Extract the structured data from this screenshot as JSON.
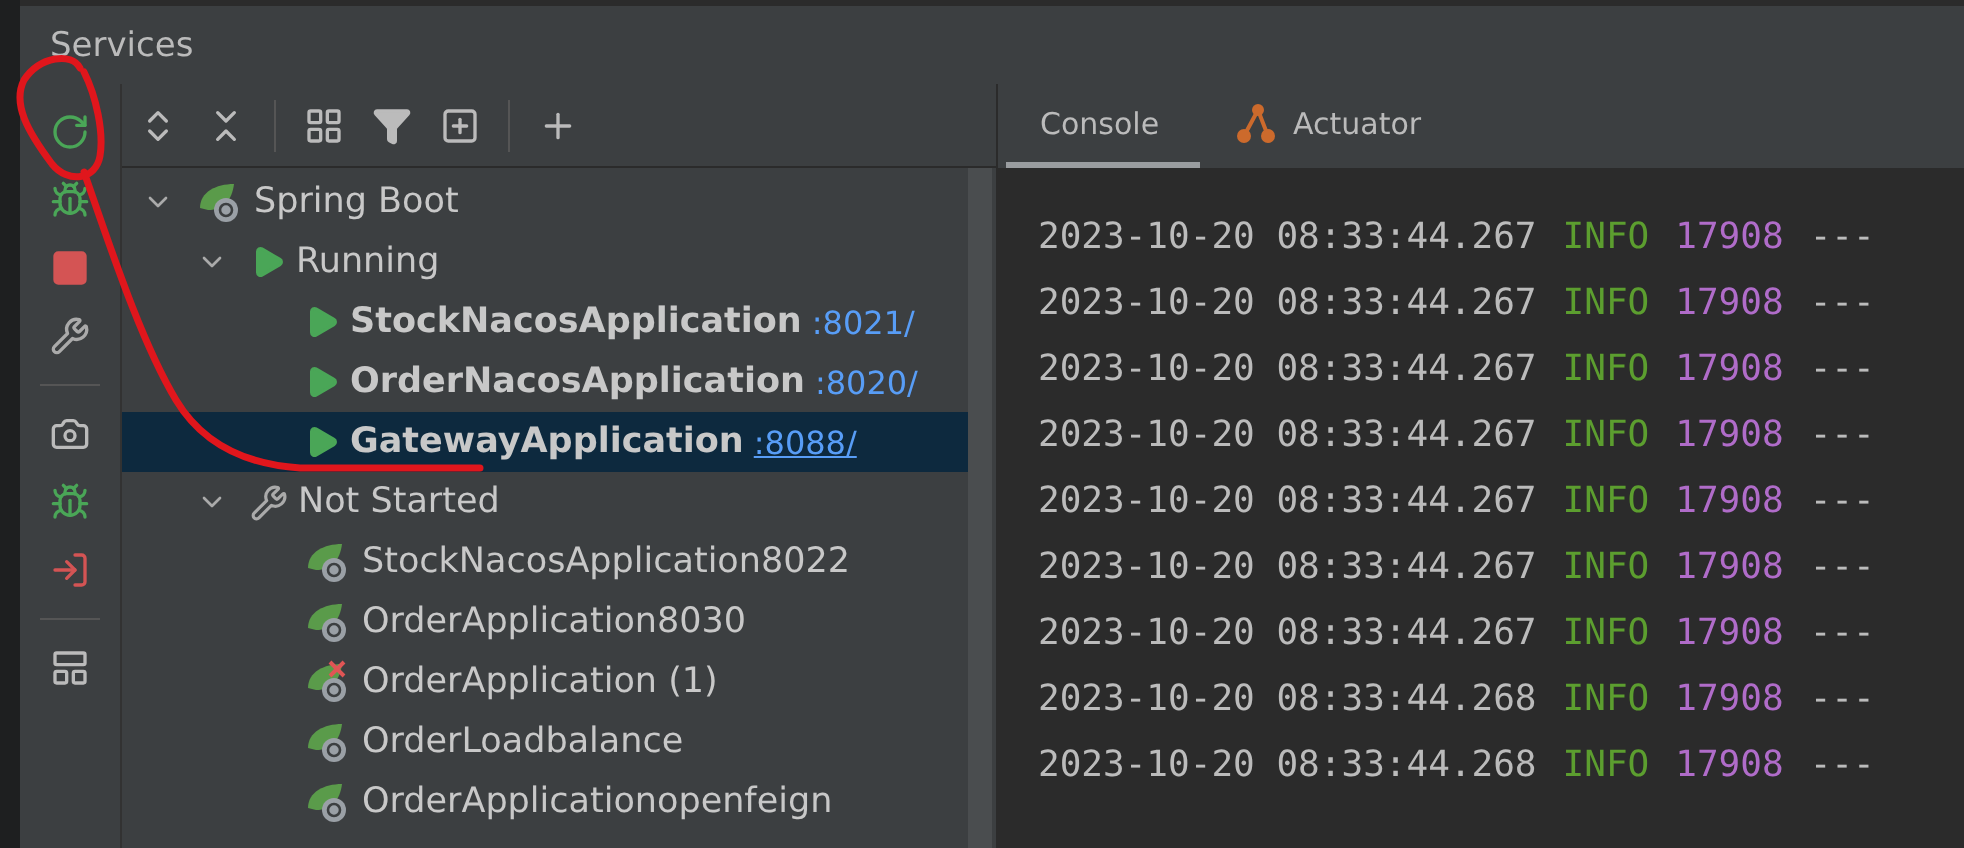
{
  "window": {
    "title": "Services"
  },
  "tabs": [
    {
      "label": "Console",
      "selected": true,
      "kind": "console"
    },
    {
      "label": "Actuator",
      "selected": false,
      "kind": "actuator"
    }
  ],
  "tree": [
    {
      "label": "Spring Boot",
      "kind": "springboot",
      "expanded": true,
      "children": [
        {
          "label": "Running",
          "kind": "running",
          "expanded": true,
          "children": [
            {
              "label": "StockNacosApplication",
              "port": ":8021/",
              "kind": "app-running",
              "selected": false
            },
            {
              "label": "OrderNacosApplication",
              "port": ":8020/",
              "kind": "app-running",
              "selected": false
            },
            {
              "label": "GatewayApplication",
              "port": ":8088/",
              "kind": "app-running",
              "selected": true
            }
          ]
        },
        {
          "label": "Not Started",
          "kind": "notstarted",
          "expanded": true,
          "children": [
            {
              "label": "StockNacosApplication8022",
              "kind": "app",
              "error": false,
              "selected": false
            },
            {
              "label": "OrderApplication8030",
              "kind": "app",
              "error": false,
              "selected": false
            },
            {
              "label": "OrderApplication (1)",
              "kind": "app",
              "error": true,
              "selected": false
            },
            {
              "label": "OrderLoadbalance",
              "kind": "app",
              "error": false,
              "selected": false
            },
            {
              "label": "OrderApplicationopenfeign",
              "kind": "app",
              "error": false,
              "selected": false
            }
          ]
        }
      ]
    }
  ],
  "log": [
    {
      "date": "2023-10-20",
      "time": "08:33:44.267",
      "level": "INFO",
      "pid": "17908",
      "sep": "---"
    },
    {
      "date": "2023-10-20",
      "time": "08:33:44.267",
      "level": "INFO",
      "pid": "17908",
      "sep": "---"
    },
    {
      "date": "2023-10-20",
      "time": "08:33:44.267",
      "level": "INFO",
      "pid": "17908",
      "sep": "---"
    },
    {
      "date": "2023-10-20",
      "time": "08:33:44.267",
      "level": "INFO",
      "pid": "17908",
      "sep": "---"
    },
    {
      "date": "2023-10-20",
      "time": "08:33:44.267",
      "level": "INFO",
      "pid": "17908",
      "sep": "---"
    },
    {
      "date": "2023-10-20",
      "time": "08:33:44.267",
      "level": "INFO",
      "pid": "17908",
      "sep": "---"
    },
    {
      "date": "2023-10-20",
      "time": "08:33:44.267",
      "level": "INFO",
      "pid": "17908",
      "sep": "---"
    },
    {
      "date": "2023-10-20",
      "time": "08:33:44.268",
      "level": "INFO",
      "pid": "17908",
      "sep": "---"
    },
    {
      "date": "2023-10-20",
      "time": "08:33:44.268",
      "level": "INFO",
      "pid": "17908",
      "sep": "---"
    }
  ]
}
